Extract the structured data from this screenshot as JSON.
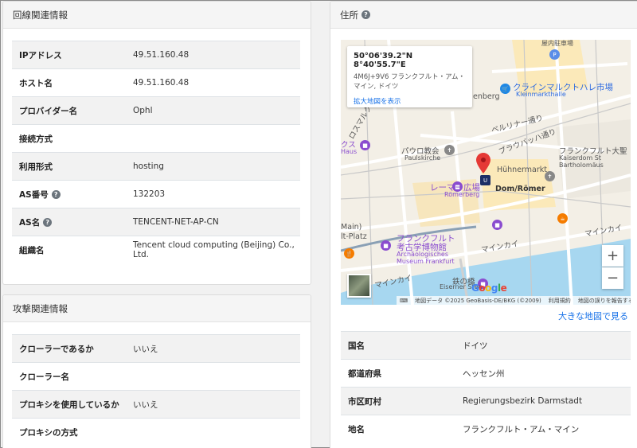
{
  "line_info": {
    "title": "回線関連情報",
    "rows": [
      {
        "key": "IPアドレス",
        "value": "49.51.160.48"
      },
      {
        "key": "ホスト名",
        "value": "49.51.160.48"
      },
      {
        "key": "プロバイダー名",
        "value": "Ophl"
      },
      {
        "key": "接続方式",
        "value": ""
      },
      {
        "key": "利用形式",
        "value": "hosting"
      },
      {
        "key": "AS番号",
        "value": "132203"
      },
      {
        "key": "AS名",
        "value": "TENCENT-NET-AP-CN"
      },
      {
        "key": "組織名",
        "value": "Tencent cloud computing (Beijing) Co., Ltd."
      }
    ]
  },
  "attack_info": {
    "title": "攻撃関連情報",
    "rows": [
      {
        "key": "クローラーであるか",
        "value": "いいえ"
      },
      {
        "key": "クローラー名",
        "value": ""
      },
      {
        "key": "プロキシを使用しているか",
        "value": "いいえ"
      },
      {
        "key": "プロキシの方式",
        "value": ""
      }
    ]
  },
  "address": {
    "title": "住所",
    "help_glyph": "?",
    "map": {
      "coord": "50°06'39.2\"N 8°40'55.7\"E",
      "plus_code_line1": "4M6J+9V6 フランクフルト・アム・",
      "plus_code_line2": "マイン, ドイツ",
      "enlarge_link": "拡大地図を表示",
      "zoom_in": "+",
      "zoom_out": "−",
      "logo": "Google",
      "attribution": {
        "keyboard": "⌨",
        "data": "地図データ ©2025 GeoBasis-DE/BKG (©2009)",
        "terms": "利用規約",
        "report": "地図の誤りを報告する"
      },
      "labels": {
        "market_hall": "クラインマルクトハレ市場",
        "market_hall_de": "Kleinmarkthalle",
        "berliner": "ベルリナー通り",
        "braubach": "ブラウバッハ通り",
        "paulskirche_jp": "パウロ教会",
        "paulskirche_de": "Paulskirche",
        "dom_jp": "フランクフルト大聖",
        "dom_de1": "Kaiserdom St",
        "dom_de2": "Bartholomäus",
        "huehnermarkt": "Hühnermarkt",
        "roemer_jp": "レーマー広場",
        "roemer_de": "Römerberg",
        "dom_roemer": "Dom/Römer",
        "museum_jp1": "フランクフルト",
        "museum_jp2": "考古学博物館",
        "museum_de1": "Archäologisches",
        "museum_de2": "Museum Frankfurt",
        "mainkai1": "マインカイ",
        "mainkai2": "マインカイ",
        "mainkai3": "マインカイ",
        "eiserner_jp": "鉄の橋",
        "eiserner_de": "Eiserner Steg",
        "main_platz1": "Main)",
        "main_platz2": "lt-Platz",
        "enberg": "enberg",
        "rosmarkt": "ロスマルク",
        "haus_jp": "クス",
        "haus_de": "Haus",
        "top_small": "屋内駐車場",
        "parking": "P",
        "subway": "U"
      }
    },
    "bigger_map_link": "大きな地図で見る",
    "rows": [
      {
        "key": "国名",
        "value": "ドイツ"
      },
      {
        "key": "都道府県",
        "value": "ヘッセン州"
      },
      {
        "key": "市区町村",
        "value": "Regierungsbezirk Darmstadt"
      },
      {
        "key": "地名",
        "value": "フランクフルト・アム・マイン"
      }
    ]
  },
  "colors": {
    "river": "#a7d7f0",
    "pin": "#e53935",
    "link": "#1a73e8",
    "purple_poi": "#8a4ccf",
    "blue_poi": "#1e88e5",
    "orange_poi": "#f57c00"
  }
}
